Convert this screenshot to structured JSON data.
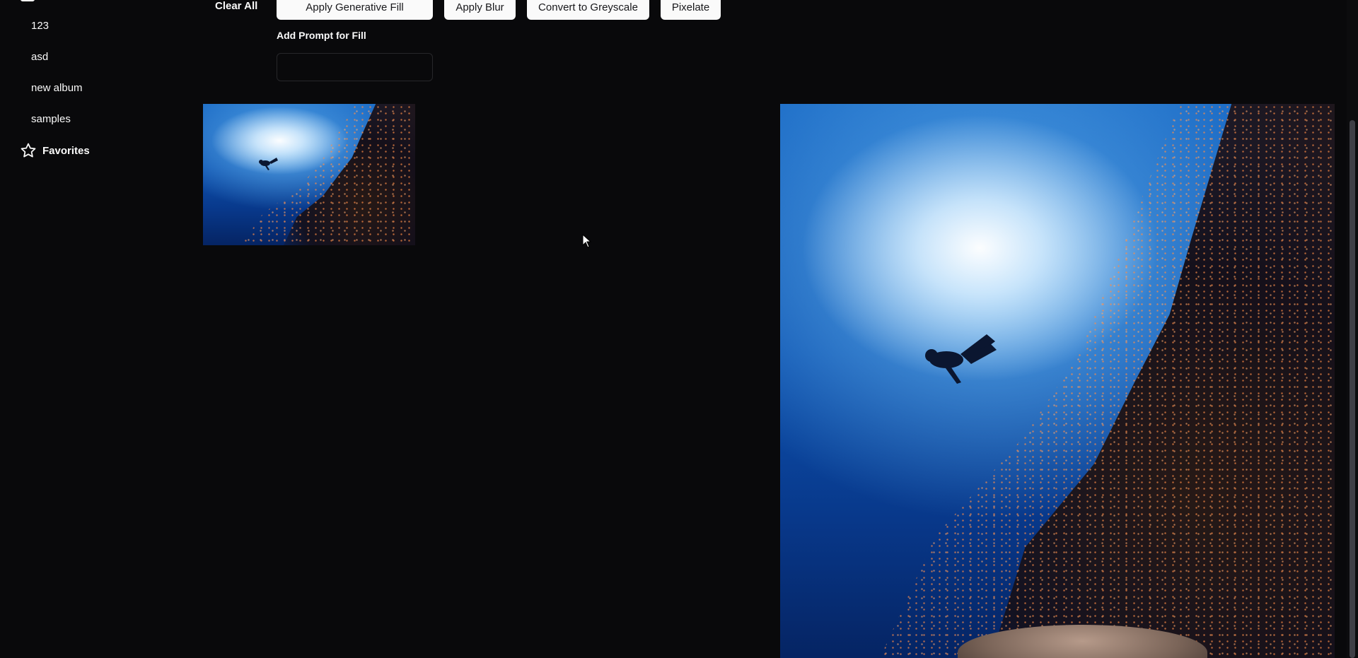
{
  "sidebar": {
    "albums": [
      {
        "label": "123"
      },
      {
        "label": "asd"
      },
      {
        "label": "new album"
      },
      {
        "label": "samples"
      }
    ],
    "favorites_label": "Favorites",
    "favorites_icon": "star-icon",
    "top_icon": "album-icon"
  },
  "toolbar": {
    "clear_all_label": "Clear All",
    "buttons": [
      {
        "label": "Apply Generative Fill"
      },
      {
        "label": "Apply Blur"
      },
      {
        "label": "Convert to Greyscale"
      },
      {
        "label": "Pixelate"
      }
    ],
    "prompt_label": "Add Prompt for Fill",
    "prompt_value": "",
    "prompt_placeholder": ""
  },
  "colors": {
    "background": "#09090b",
    "text": "#fafafa",
    "button_bg": "#fafafa",
    "button_text": "#18181b",
    "input_border": "#27272a"
  }
}
